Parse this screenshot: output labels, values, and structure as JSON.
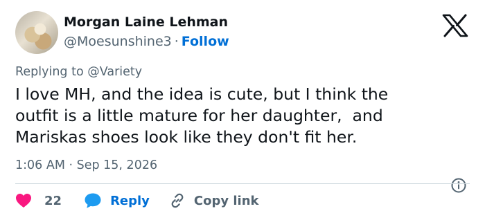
{
  "author": {
    "name": "Morgan Laine Lehman",
    "handle": "@Moesunshine3",
    "separator": "·",
    "follow_label": "Follow"
  },
  "replying": {
    "prefix": "Replying to ",
    "mention": "@Variety"
  },
  "tweet": {
    "lines": [
      "I love MH, and the idea is cute, but I think the",
      "outfit is a little mature for her daughter,  and",
      "Mariskas shoes look like they don't fit her."
    ]
  },
  "timestamp": "1:06 AM · Sep 15, 2026",
  "actions": {
    "like_count": "22",
    "reply_label": "Reply",
    "copy_link_label": "Copy link"
  },
  "icons": {
    "brand": "x-logo-icon",
    "info": "info-icon",
    "like": "heart-icon",
    "reply": "speech-bubble-icon",
    "copy": "link-icon"
  },
  "colors": {
    "text": "#0f1419",
    "secondary": "#536471",
    "link": "#006fd6",
    "like": "#f91880",
    "reply_bubble": "#1d9bf0",
    "divider": "#cfd9de"
  }
}
